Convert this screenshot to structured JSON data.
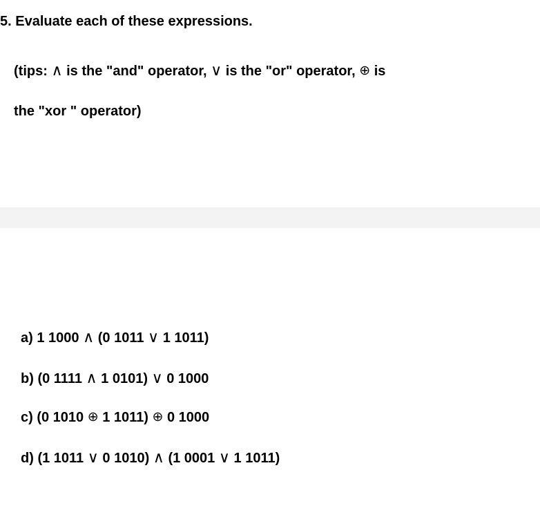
{
  "question": {
    "number": "5.",
    "prompt": "Evaluate each of these expressions.",
    "tips_prefix": "(tips: ",
    "and_sym": "∧",
    "and_desc": " is the \"and\" operator, ",
    "or_sym": "∨",
    "or_desc": " is the \"or\" operator, ",
    "xor_sym": "⊕",
    "xor_desc": " is",
    "tips_line2": "the \"xor \"  operator)"
  },
  "items": {
    "a": {
      "label": "a) ",
      "p1": "1 1000 ",
      "op1": "∧",
      "p2": " (0 1011 ",
      "op2": "∨",
      "p3": " 1 1011)"
    },
    "b": {
      "label": "b) ",
      "p1": "(0 1111 ",
      "op1": "∧",
      "p2": " 1 0101) ",
      "op2": "∨",
      "p3": " 0 1000"
    },
    "c": {
      "label": "c) ",
      "p1": "(0 1010 ",
      "op1": "⊕",
      "p2": " 1 1011) ",
      "op2": "⊕",
      "p3": " 0 1000"
    },
    "d": {
      "label": "d) ",
      "p1": "(1 1011 ",
      "op1": "∨",
      "p2": " 0 1010) ",
      "op2": "∧",
      "p3": " (1 0001 ",
      "op3": "∨",
      "p4": " 1 1011)"
    }
  }
}
